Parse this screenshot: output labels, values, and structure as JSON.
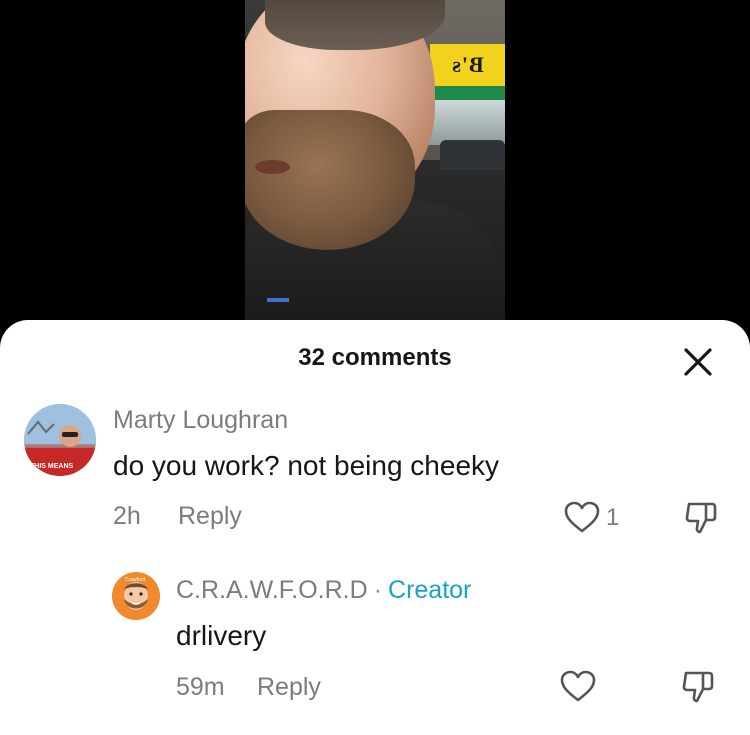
{
  "video": {
    "sign_text": "B's MIN",
    "icons": [
      "video-frame"
    ]
  },
  "comments_panel": {
    "title": "32 comments",
    "close_icon": "close-icon"
  },
  "comments": [
    {
      "author": "Marty Loughran",
      "text": "do you work? not being cheeky",
      "time": "2h",
      "reply_label": "Reply",
      "like_count": "1",
      "avatar_text": "THIS MEANS"
    },
    {
      "author": "C.R.A.W.F.O.R.D",
      "author_separator": "·",
      "badge": "Creator",
      "text": "drlivery",
      "time": "59m",
      "reply_label": "Reply",
      "avatar_text": "Crawford"
    }
  ],
  "colors": {
    "creator_badge": "#18a3c4",
    "meta_text": "#7c7c7c",
    "body_text": "#161616"
  }
}
